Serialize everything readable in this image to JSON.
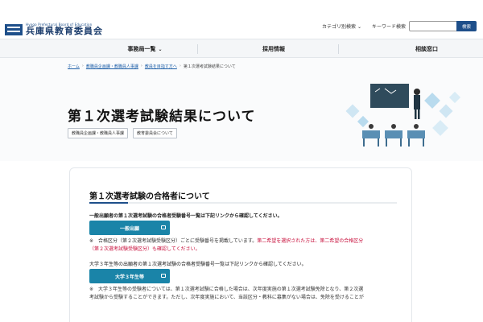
{
  "header": {
    "logo_sub": "Hyogo Prefectural Board of Education",
    "logo_main": "兵庫県教育委員会",
    "category_search": "カテゴリ別検索",
    "keyword_search": "キーワード検索",
    "search_placeholder": "",
    "search_button": "検索"
  },
  "nav": {
    "items": [
      {
        "label": "事務局一覧"
      },
      {
        "label": "採用情報"
      },
      {
        "label": "相談窓口"
      }
    ]
  },
  "breadcrumb": {
    "items": [
      "ホーム",
      "教職員企画課・教職員人事課",
      "教員を目指す方へ",
      "第１次選考試験結果について"
    ]
  },
  "page": {
    "title": "第１次選考試験結果について",
    "tags": [
      "教職員企画課・教職員人事課",
      "教育委員会について"
    ]
  },
  "content": {
    "section_title": "第１次選考試験の合格者について",
    "para1": "一般出願者の第１次選考試験の合格者受験番号一覧は下記リンクから確認してください。",
    "button1": "一般出願",
    "note1_a": "※　合格区分（第２次選考試験受験区分）ごとに受験番号を掲載しています。",
    "note1_red1": "第二希望を選択された方は、第二希望の合格区分",
    "note1_red2": "（第２次選考試験受験区分）も確認してください。",
    "para2": "大学３年生等の出願者の第１次選考試験の合格者受験番号一覧は下記リンクから確認してください。",
    "button2": "大学３年生等",
    "note2_line1": "※　大学３年生等の受験者については、第１次選考試験に合格した場合は、次年度実施の第１次選考試験免除となり、第２次選",
    "note2_line2": "考試験から受験することができます。ただし、次年度実施において、当該区分・教科に募集がない場合は、免除を受けることが"
  }
}
